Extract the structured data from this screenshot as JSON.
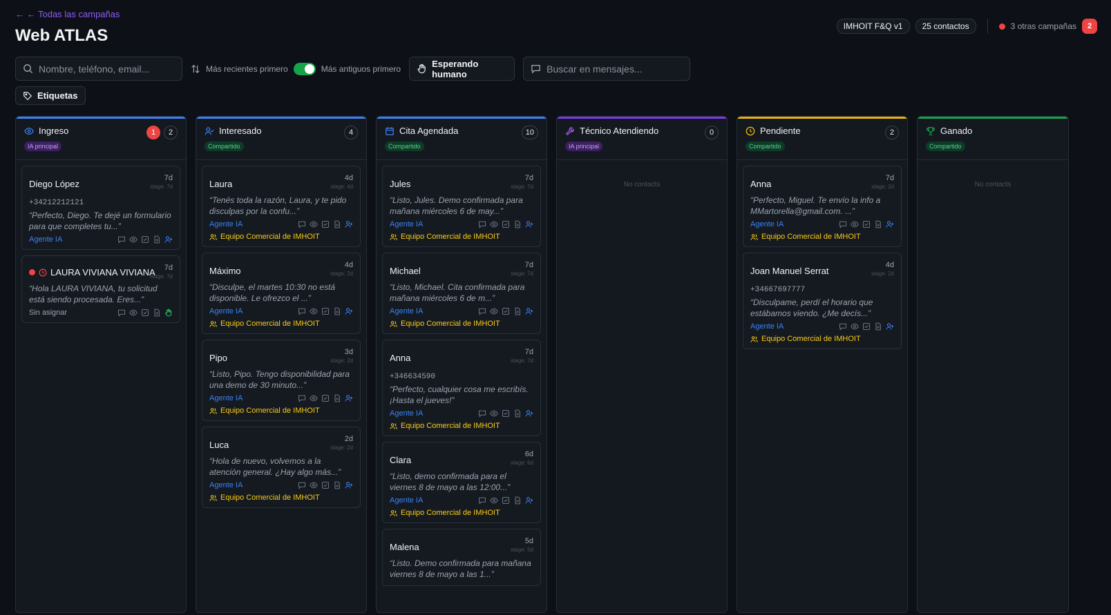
{
  "header": {
    "back_label": "← ← Todas las campañas",
    "title": "Web ATLAS",
    "flow_pill": "IMHOIT F&Q v1",
    "contacts_pill": "25 contactos",
    "other_campaigns": "3 otras campañas",
    "other_campaigns_count": "2"
  },
  "toolbar": {
    "search_placeholder": "Nombre, teléfono, email...",
    "sort_recent": "Más recientes primero",
    "sort_oldest": "Más antiguos primero",
    "waiting_button": "Esperando humano",
    "msg_search_placeholder": "Buscar en mensajes...",
    "tags_button": "Etiquetas"
  },
  "columns": [
    {
      "title": "Ingreso",
      "badge": "IA principal",
      "badge_kind": "purple",
      "alert": "1",
      "count": "2",
      "color": "#3b82f6",
      "icon": "eye-icon"
    },
    {
      "title": "Interesado",
      "badge": "Compartido",
      "badge_kind": "green",
      "count": "4",
      "color": "#3b82f6",
      "icon": "user-check-icon"
    },
    {
      "title": "Cita Agendada",
      "badge": "Compartido",
      "badge_kind": "green",
      "count": "10",
      "color": "#3b82f6",
      "icon": "calendar-icon"
    },
    {
      "title": "Técnico Atendiendo",
      "badge": "IA principal",
      "badge_kind": "purple",
      "count": "0",
      "color": "#7c3aed",
      "icon": "wrench-icon",
      "empty": "No contacts"
    },
    {
      "title": "Pendiente",
      "badge": "Compartido",
      "badge_kind": "green",
      "count": "2",
      "color": "#eab308",
      "icon": "clock-icon"
    },
    {
      "title": "Ganado",
      "badge": "Compartido",
      "badge_kind": "green",
      "color": "#16a34a",
      "icon": "trophy-icon",
      "empty": "No contacts"
    }
  ],
  "cards": {
    "c0_0": {
      "name": "Diego López",
      "age": "7d",
      "stage": "stage: 7d",
      "phone": "+34212212121",
      "msg": "“Perfecto, Diego. Te dejé un formulario para que completes tu...”",
      "agent": "Agente IA"
    },
    "c0_1": {
      "name": "LAURA VIVIANA VIVIANA",
      "age": "7d",
      "stage": "stage: 7d",
      "msg": "“Hola LAURA VIVIANA, tu solicitud está siendo procesada. Eres...”",
      "agent": "Sin asignar"
    },
    "c1_0": {
      "name": "Laura",
      "age": "4d",
      "stage": "stage: 4d",
      "msg": "“Tenés toda la razón, Laura, y te pido disculpas por la confu...”",
      "agent": "Agente IA",
      "team": "Equipo Comercial de IMHOIT"
    },
    "c1_1": {
      "name": "Máximo",
      "age": "4d",
      "stage": "stage: 2d",
      "msg": "“Disculpe, el martes 10:30 no está disponible. Le ofrezco el ...”",
      "agent": "Agente IA",
      "team": "Equipo Comercial de IMHOIT"
    },
    "c1_2": {
      "name": "Pipo",
      "age": "3d",
      "stage": "stage: 2d",
      "msg": "“Listo, Pipo. Tengo disponibilidad para una demo de 30 minuto...”",
      "agent": "Agente IA",
      "team": "Equipo Comercial de IMHOIT"
    },
    "c1_3": {
      "name": "Luca",
      "age": "2d",
      "stage": "stage: 2d",
      "msg": "“Hola de nuevo, volvemos a la atención general. ¿Hay algo más...”",
      "agent": "Agente IA",
      "team": "Equipo Comercial de IMHOIT"
    },
    "c2_0": {
      "name": "Jules",
      "age": "7d",
      "stage": "stage: 7d",
      "msg": "“Listo, Jules. Demo confirmada para mañana miércoles 6 de may...”",
      "agent": "Agente IA",
      "team": "Equipo Comercial de IMHOIT"
    },
    "c2_1": {
      "name": "Michael",
      "age": "7d",
      "stage": "stage: 7d",
      "msg": "“Listo, Michael. Cita confirmada para mañana miércoles 6 de m...”",
      "agent": "Agente IA",
      "team": "Equipo Comercial de IMHOIT"
    },
    "c2_2": {
      "name": "Anna",
      "age": "7d",
      "stage": "stage: 7d",
      "phone": "+346634590",
      "msg": "“Perfecto, cualquier cosa me escribís. ¡Hasta el jueves!”",
      "agent": "Agente IA",
      "team": "Equipo Comercial de IMHOIT"
    },
    "c2_3": {
      "name": "Clara",
      "age": "6d",
      "stage": "stage: 6d",
      "msg": "“Listo, demo confirmada para el viernes 8 de mayo a las 12:00...”",
      "agent": "Agente IA",
      "team": "Equipo Comercial de IMHOIT"
    },
    "c2_4": {
      "name": "Malena",
      "age": "5d",
      "stage": "stage: 5d",
      "msg": "“Listo. Demo confirmada para mañana viernes 8 de mayo a las 1...”"
    },
    "c4_0": {
      "name": "Anna",
      "age": "7d",
      "stage": "stage: 2d",
      "msg": "“Perfecto, Miguel. Te envío la info a MMartorella@gmail.com. ...”",
      "agent": "Agente IA",
      "team": "Equipo Comercial de IMHOIT"
    },
    "c4_1": {
      "name": "Joan Manuel Serrat",
      "age": "4d",
      "stage": "stage: 2d",
      "phone": "+34667697777",
      "msg": "“Disculpame, perdí el horario que estábamos viendo. ¿Me decís...”",
      "agent": "Agente IA",
      "team": "Equipo Comercial de IMHOIT"
    }
  }
}
